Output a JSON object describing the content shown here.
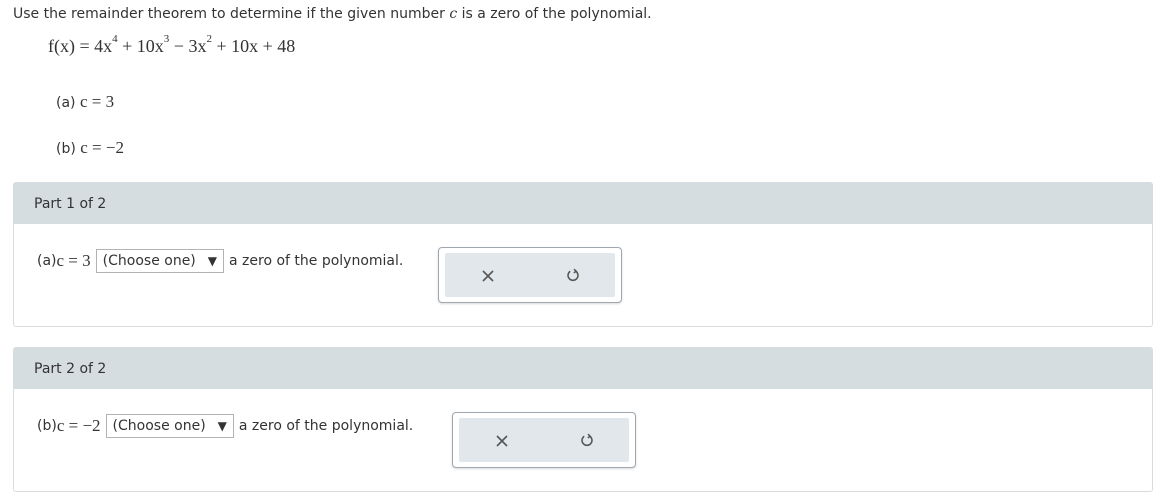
{
  "prompt": {
    "text_before": "Use the remainder theorem to determine if the given number ",
    "var": "c",
    "text_after": " is a zero of the polynomial."
  },
  "polynomial": {
    "lhs": "f(x) = ",
    "t1_coef": "4x",
    "t1_exp": "4",
    "t2_coef": " + 10x",
    "t2_exp": "3",
    "t3_coef": " − 3x",
    "t3_exp": "2",
    "rest": " + 10x + 48"
  },
  "items": [
    {
      "label": "(a) ",
      "expr": "c = 3"
    },
    {
      "label": "(b) ",
      "expr": "c = −2"
    }
  ],
  "parts": [
    {
      "header": "Part 1 of 2",
      "label": "(a) ",
      "expr": "c = 3",
      "select_value": "(Choose one)",
      "suffix": "a zero of the polynomial.",
      "clear_icon": "×",
      "undo_icon": "↺"
    },
    {
      "header": "Part 2 of 2",
      "label": "(b) ",
      "expr": "c = −2",
      "select_value": "(Choose one)",
      "suffix": "a zero of the polynomial.",
      "clear_icon": "×",
      "undo_icon": "↺"
    }
  ],
  "icons": {
    "dropdown": "▼"
  },
  "colors": {
    "header_bg": "#d5dde1",
    "action_bg": "#e1e7ea",
    "text": "#333333"
  }
}
